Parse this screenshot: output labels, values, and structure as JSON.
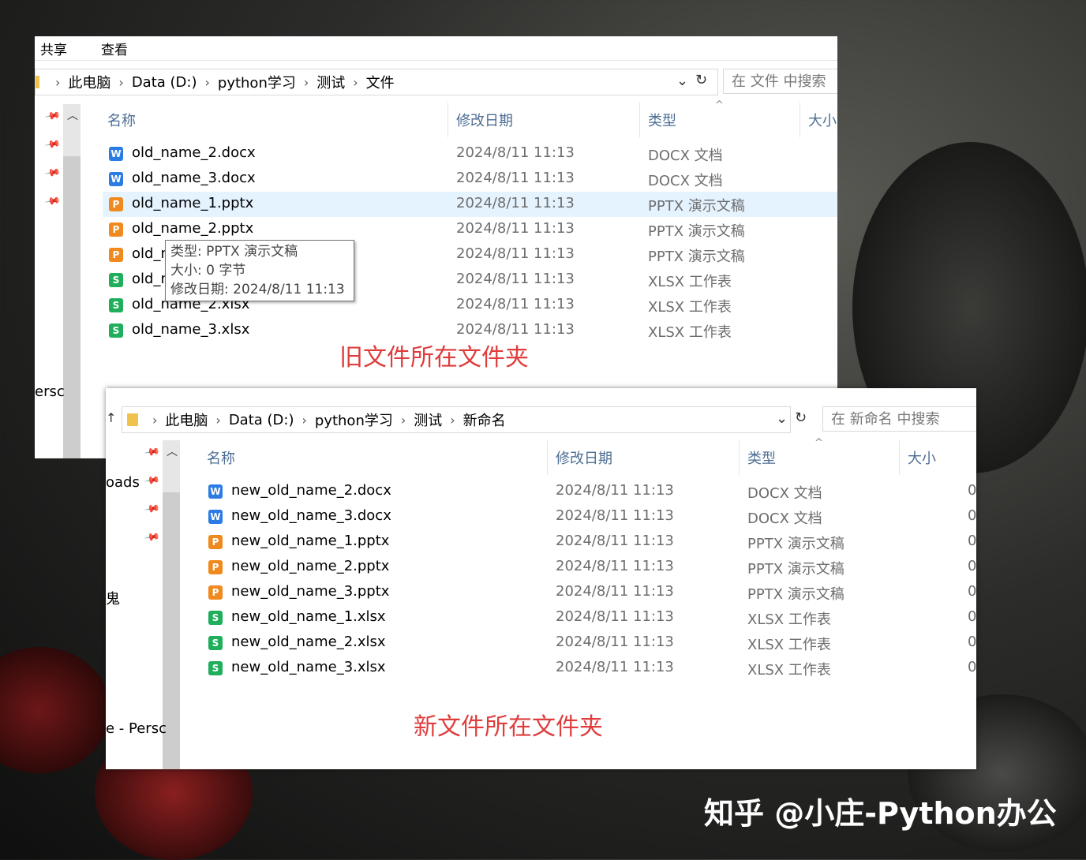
{
  "window1": {
    "menu": [
      "共享",
      "查看"
    ],
    "breadcrumb": [
      "此电脑",
      "Data (D:)",
      "python学习",
      "测试",
      "文件"
    ],
    "search_placeholder": "在 文件 中搜索",
    "columns": [
      "名称",
      "修改日期",
      "类型",
      "大小"
    ],
    "side_label": "ersc",
    "files": [
      {
        "name": "old_name_2.docx",
        "date": "2024/8/11 11:13",
        "type": "DOCX 文档",
        "kind": "docx",
        "icon": "word-icon"
      },
      {
        "name": "old_name_3.docx",
        "date": "2024/8/11 11:13",
        "type": "DOCX 文档",
        "kind": "docx",
        "icon": "word-icon"
      },
      {
        "name": "old_name_1.pptx",
        "date": "2024/8/11 11:13",
        "type": "PPTX 演示文稿",
        "kind": "pptx",
        "icon": "ppt-icon",
        "selected": true
      },
      {
        "name": "old_name_2.pptx",
        "date": "2024/8/11 11:13",
        "type": "PPTX 演示文稿",
        "kind": "pptx",
        "icon": "ppt-icon"
      },
      {
        "name": "old_n",
        "date": "2024/8/11 11:13",
        "type": "PPTX 演示文稿",
        "kind": "pptx",
        "icon": "ppt-icon"
      },
      {
        "name": "old_n",
        "date": "2024/8/11 11:13",
        "type": "XLSX 工作表",
        "kind": "xlsx",
        "icon": "sheet-icon"
      },
      {
        "name": "old_name_2.xlsx",
        "date": "2024/8/11 11:13",
        "type": "XLSX 工作表",
        "kind": "xlsx",
        "icon": "sheet-icon"
      },
      {
        "name": "old_name_3.xlsx",
        "date": "2024/8/11 11:13",
        "type": "XLSX 工作表",
        "kind": "xlsx",
        "icon": "sheet-icon"
      }
    ],
    "tooltip": [
      "类型: PPTX 演示文稿",
      "大小: 0 字节",
      "修改日期: 2024/8/11 11:13"
    ],
    "annotation": "旧文件所在文件夹"
  },
  "window2": {
    "breadcrumb": [
      "此电脑",
      "Data (D:)",
      "python学习",
      "测试",
      "新命名"
    ],
    "search_placeholder": "在 新命名 中搜索",
    "columns": [
      "名称",
      "修改日期",
      "类型",
      "大小"
    ],
    "side_labels": [
      "oads",
      "鬼",
      "e - Persc"
    ],
    "files": [
      {
        "name": "new_old_name_2.docx",
        "date": "2024/8/11 11:13",
        "type": "DOCX 文档",
        "size": "0",
        "kind": "docx",
        "icon": "word-icon"
      },
      {
        "name": "new_old_name_3.docx",
        "date": "2024/8/11 11:13",
        "type": "DOCX 文档",
        "size": "0",
        "kind": "docx",
        "icon": "word-icon"
      },
      {
        "name": "new_old_name_1.pptx",
        "date": "2024/8/11 11:13",
        "type": "PPTX 演示文稿",
        "size": "0",
        "kind": "pptx",
        "icon": "ppt-icon"
      },
      {
        "name": "new_old_name_2.pptx",
        "date": "2024/8/11 11:13",
        "type": "PPTX 演示文稿",
        "size": "0",
        "kind": "pptx",
        "icon": "ppt-icon"
      },
      {
        "name": "new_old_name_3.pptx",
        "date": "2024/8/11 11:13",
        "type": "PPTX 演示文稿",
        "size": "0",
        "kind": "pptx",
        "icon": "ppt-icon"
      },
      {
        "name": "new_old_name_1.xlsx",
        "date": "2024/8/11 11:13",
        "type": "XLSX 工作表",
        "size": "0",
        "kind": "xlsx",
        "icon": "sheet-icon"
      },
      {
        "name": "new_old_name_2.xlsx",
        "date": "2024/8/11 11:13",
        "type": "XLSX 工作表",
        "size": "0",
        "kind": "xlsx",
        "icon": "sheet-icon"
      },
      {
        "name": "new_old_name_3.xlsx",
        "date": "2024/8/11 11:13",
        "type": "XLSX 工作表",
        "size": "0",
        "kind": "xlsx",
        "icon": "sheet-icon"
      }
    ],
    "annotation": "新文件所在文件夹"
  },
  "watermark": "知乎 @小庄-Python办公",
  "icon_glyphs": {
    "docx": "W",
    "pptx": "P",
    "xlsx": "S"
  },
  "colors": {
    "annotation": "#e03c3c",
    "header_text": "#4d6e94",
    "selection": "#e5f3ff",
    "docx": "#2b7be4",
    "pptx": "#f08a1f",
    "xlsx": "#1fae5b"
  }
}
